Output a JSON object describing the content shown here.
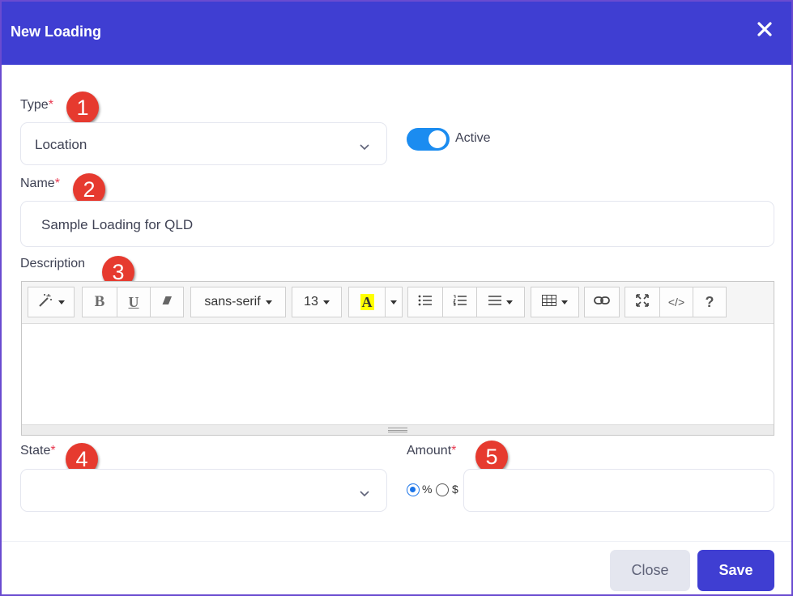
{
  "dialog": {
    "title": "New Loading",
    "close_icon": "close-icon"
  },
  "type_field": {
    "label": "Type",
    "required_mark": "*",
    "value": "Location",
    "badge": "1"
  },
  "active_toggle": {
    "label": "Active",
    "state": true,
    "color": "#1b8cf0"
  },
  "name_field": {
    "label": "Name",
    "required_mark": "*",
    "value": "Sample Loading for QLD",
    "badge": "2"
  },
  "description_field": {
    "label": "Description",
    "badge": "3",
    "toolbar": {
      "magic_icon": "magic-wand-icon",
      "bold": "B",
      "underline": "U",
      "eraser_icon": "eraser-icon",
      "font_family": "sans-serif",
      "font_size": "13",
      "color_letter": "A",
      "ul_icon": "unordered-list-icon",
      "ol_icon": "ordered-list-icon",
      "align_icon": "align-icon",
      "table_icon": "table-icon",
      "link_icon": "link-icon",
      "fullscreen_icon": "fullscreen-icon",
      "code_label": "</>",
      "help_label": "?"
    },
    "content": ""
  },
  "state_field": {
    "label": "State",
    "required_mark": "*",
    "value": "",
    "badge": "4"
  },
  "amount_field": {
    "label": "Amount",
    "required_mark": "*",
    "value": "",
    "badge": "5",
    "unit_options": [
      "%",
      "$"
    ],
    "selected_unit": "%"
  },
  "footer": {
    "close_label": "Close",
    "save_label": "Save"
  },
  "colors": {
    "header": "#3f3ed2",
    "required": "#e8384f",
    "badge": "#e63a2f"
  }
}
